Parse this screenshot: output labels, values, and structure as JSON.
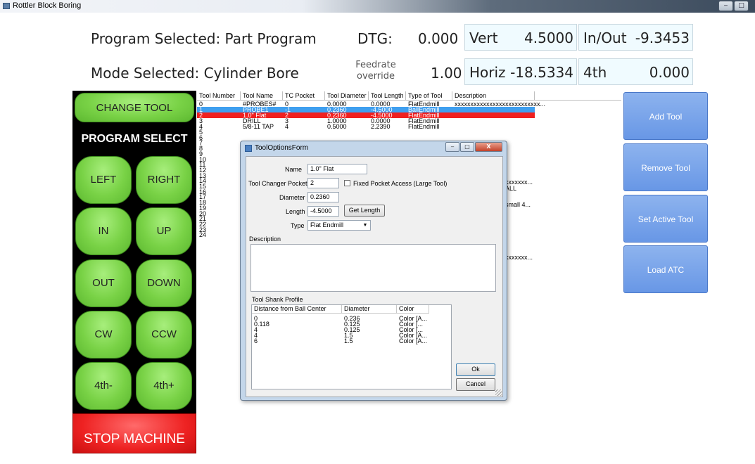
{
  "window": {
    "title": "Rottler Block Boring",
    "minimize": "‒",
    "maximize": "□"
  },
  "header": {
    "program_selected": "Program Selected: Part Program",
    "mode_selected": "Mode Selected: Cylinder Bore",
    "dtg_label": "DTG:",
    "dtg_value": "0.000",
    "feedrate_label_1": "Feedrate",
    "feedrate_label_2": "override",
    "feedrate_value": "1.00",
    "vert_label": "Vert",
    "vert_value": "4.5000",
    "inout_label": "In/Out",
    "inout_value": "-9.3453",
    "horiz_label": "Horiz",
    "horiz_value": "-18.5334",
    "fourth_label": "4th",
    "fourth_value": "0.000"
  },
  "left_panel": {
    "change_tool": "CHANGE TOOL",
    "program_select": "PROGRAM SELECT",
    "left": "LEFT",
    "right": "RIGHT",
    "in": "IN",
    "up": "UP",
    "out": "OUT",
    "down": "DOWN",
    "cw": "CW",
    "ccw": "CCW",
    "fourth_minus": "4th-",
    "fourth_plus": "4th+",
    "stop": "STOP MACHINE"
  },
  "tool_table": {
    "headers": [
      "Tool Number",
      "Tool Name",
      "TC Pocket",
      "Tool Diameter",
      "Tool Length",
      "Type of Tool",
      "Description"
    ],
    "rows": [
      [
        "0",
        "#PROBES#",
        "0",
        "0.0000",
        "0.0000",
        "FlatEndmill",
        "xxxxxxxxxxxxxxxxxxxxxxxxxxx..."
      ],
      [
        "1",
        "PROBE1",
        "-1",
        "0.2360",
        "-4.5000",
        "BallEndmill",
        ""
      ],
      [
        "2",
        "1.0\" Flat",
        "2",
        "0.2360",
        "-4.5000",
        "FlatEndmill",
        ""
      ],
      [
        "3",
        "DRILL",
        "3",
        "1.0000",
        "0.0000",
        "FlatEndmill",
        ""
      ],
      [
        "4",
        "5/8-11 TAP",
        "4",
        "0.5000",
        "2.2390",
        "FlatEndmill",
        ""
      ]
    ],
    "more_numbers": [
      "5",
      "6",
      "7",
      "8",
      "9",
      "10",
      "11",
      "12",
      "13",
      "14",
      "15",
      "16",
      "17",
      "18",
      "19",
      "20",
      "21",
      "22",
      "23",
      "24"
    ],
    "right_fragments": [
      "xxxxxxx...",
      "ALL",
      "small 4...",
      "xxxxxxx..."
    ]
  },
  "right_buttons": {
    "add_tool": "Add Tool",
    "remove_tool": "Remove Tool",
    "set_active_tool": "Set Active Tool",
    "load_atc": "Load ATC"
  },
  "dialog": {
    "title": "ToolOptionsForm",
    "name_label": "Name",
    "name_value": "1.0\" Flat",
    "pocket_label": "Tool Changer Pocket",
    "pocket_value": "2",
    "fixed_pocket_label": "Fixed Pocket Access (Large Tool)",
    "diameter_label": "Diameter",
    "diameter_value": "0.2360",
    "length_label": "Length",
    "length_value": "-4.5000",
    "get_length": "Get Length",
    "type_label": "Type",
    "type_value": "Flat Endmill",
    "description_label": "Description",
    "shank_label": "Tool Shank Profile",
    "shank_headers": [
      "Distance from Ball Center",
      "Diameter",
      "Color"
    ],
    "shank_rows": [
      [
        "0",
        "0.236",
        "Color [A..."
      ],
      [
        "0.118",
        "0.125",
        "Color [..."
      ],
      [
        "4",
        "0.125",
        "Color [..."
      ],
      [
        "4",
        "1.5",
        "Color [A..."
      ],
      [
        "6",
        "1.5",
        "Color [A..."
      ]
    ],
    "ok": "Ok",
    "cancel": "Cancel",
    "win_min": "‒",
    "win_max": "□",
    "win_close": "X"
  }
}
